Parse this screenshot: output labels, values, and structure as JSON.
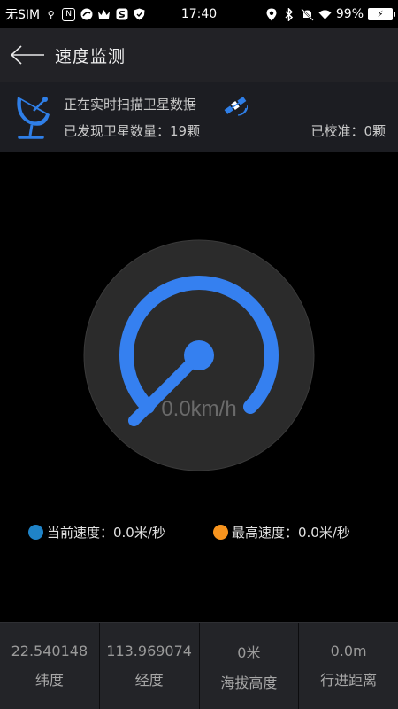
{
  "status_bar": {
    "carrier": "无SIM",
    "time": "17:40",
    "battery": "99%",
    "left_icons": [
      "usb-icon",
      "nfc-icon",
      "app-icon-circle",
      "crown-icon",
      "app-icon-s",
      "shield-icon"
    ],
    "right_icons": [
      "location-icon",
      "bluetooth-icon",
      "mute-bell-icon",
      "wifi-icon",
      "battery-icon"
    ]
  },
  "header": {
    "title": "速度监测",
    "back_icon": "back-arrow-icon"
  },
  "satellite": {
    "scanning_text": "正在实时扫描卫星数据",
    "found_label": "已发现卫星数量：",
    "found_count": "19颗",
    "calibrated_label": "已校准：",
    "calibrated_count": "0颗",
    "dish_icon": "satellite-dish-icon",
    "sat_icon": "satellite-icon"
  },
  "gauge": {
    "speed_text": "0.0km/h",
    "speed_value": 0.0,
    "arc_color": "#3580f0",
    "face_color": "#2b2b2b"
  },
  "legend": {
    "current": {
      "label": "当前速度：0.0米/秒",
      "color": "#1f83c7"
    },
    "max": {
      "label": "最高速度：0.0米/秒",
      "color": "#f7941e"
    }
  },
  "stats": [
    {
      "value": "22.540148",
      "label": "纬度"
    },
    {
      "value": "113.969074",
      "label": "经度"
    },
    {
      "value": "0米",
      "label": "海拔高度"
    },
    {
      "value": "0.0m",
      "label": "行进距离"
    }
  ]
}
